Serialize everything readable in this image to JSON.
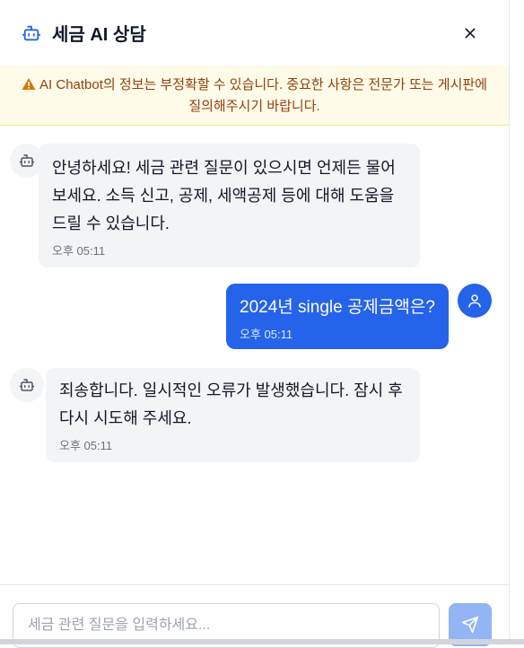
{
  "header": {
    "title": "세금 AI 상담",
    "icon": "bot-icon",
    "close_icon": "close-icon"
  },
  "warning": {
    "icon": "warning-icon",
    "text": "AI Chatbot의 정보는 부정확할 수 있습니다. 중요한 사항은 전문가 또는 게시판에 질의해주시기 바랍니다."
  },
  "messages": [
    {
      "role": "bot",
      "text": "안녕하세요! 세금 관련 질문이 있으시면 언제든 물어보세요. 소득 신고, 공제, 세액공제 등에 대해 도움을 드릴 수 있습니다.",
      "time": "오후 05:11"
    },
    {
      "role": "user",
      "text": "2024년 single 공제금액은?",
      "time": "오후 05:11"
    },
    {
      "role": "bot",
      "text": "죄송합니다. 일시적인 오류가 발생했습니다. 잠시 후 다시 시도해 주세요.",
      "time": "오후 05:11"
    }
  ],
  "input": {
    "placeholder": "세금 관련 질문을 입력하세요..."
  },
  "colors": {
    "accent": "#2563eb",
    "warning_bg": "#fefce8",
    "warning_text": "#92400e",
    "send_disabled": "#93b4f5"
  }
}
